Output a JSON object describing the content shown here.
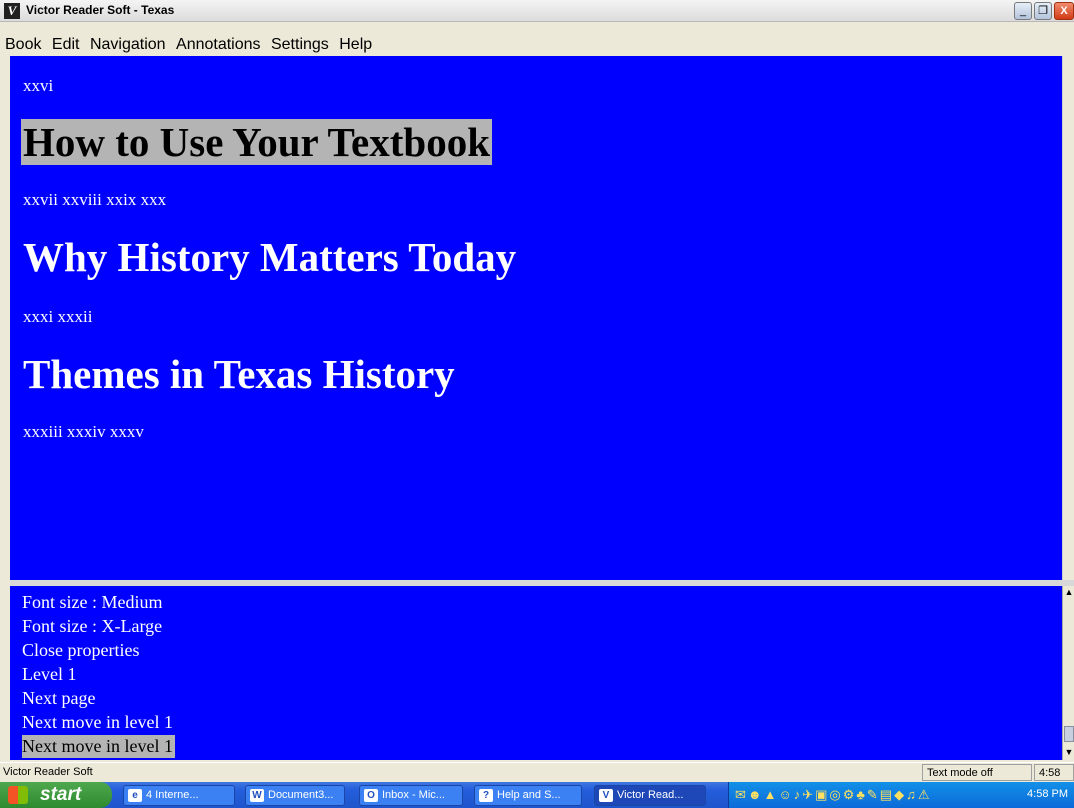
{
  "window": {
    "title": "Victor Reader Soft - Texas",
    "app_icon": "V",
    "buttons": {
      "minimize": "_",
      "maximize": "❐",
      "close": "X"
    }
  },
  "menu": [
    "Book",
    "Edit",
    "Navigation",
    "Annotations",
    "Settings",
    "Help"
  ],
  "content": {
    "page_1": "xxvi",
    "heading_1": "How to Use Your Textbook",
    "pages_2": "xxvii xxviii xxix xxx",
    "heading_2": "Why History Matters Today",
    "pages_3": "xxxi xxxii",
    "heading_3": "Themes in Texas History",
    "pages_4": "xxxiii xxxiv xxxv"
  },
  "history_list": [
    "Font size : Medium",
    "Font size : X-Large",
    "Close properties",
    "Level 1",
    "Next page",
    "Next move in level 1",
    "Next move in level 1"
  ],
  "statusbar": {
    "app_name": "Victor Reader Soft",
    "mode": "Text mode off",
    "time": "4:58"
  },
  "taskbar": {
    "start": "start",
    "tasks": [
      {
        "label": "4 Interne...",
        "icon": "e"
      },
      {
        "label": "Document3...",
        "icon": "W"
      },
      {
        "label": "Inbox - Mic...",
        "icon": "O"
      },
      {
        "label": "Help and S...",
        "icon": "?"
      },
      {
        "label": "Victor Read...",
        "icon": "V"
      }
    ],
    "clock": "4:58 PM"
  }
}
